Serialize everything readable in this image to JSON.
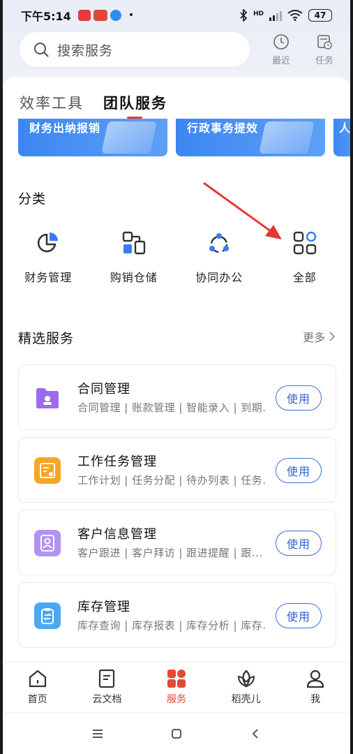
{
  "status_bar": {
    "time": "下午5:14",
    "battery": "47",
    "hd_label": "HD"
  },
  "search": {
    "placeholder": "搜索服务"
  },
  "top_actions": {
    "recent_label": "最近",
    "tasks_label": "任务"
  },
  "tabs": [
    {
      "label": "效率工具",
      "active": false
    },
    {
      "label": "团队服务",
      "active": true
    }
  ],
  "banners": [
    {
      "label": "财务出纳报销"
    },
    {
      "label": "行政事务提效"
    },
    {
      "label": "人"
    }
  ],
  "categories_section": {
    "title": "分类",
    "items": [
      {
        "label": "财务管理",
        "icon": "pie-chart-icon"
      },
      {
        "label": "购销仓储",
        "icon": "boxes-icon"
      },
      {
        "label": "协同办公",
        "icon": "collaboration-icon"
      },
      {
        "label": "全部",
        "icon": "grid-icon"
      }
    ]
  },
  "featured_section": {
    "title": "精选服务",
    "more_label": "更多"
  },
  "services": [
    {
      "name": "合同管理",
      "desc": "合同管理 | 账款管理 | 智能录入 | 到期...",
      "button": "使用",
      "icon": "contract-folder-icon",
      "color": "#8a5ce6"
    },
    {
      "name": "工作任务管理",
      "desc": "工作计划 | 任务分配 | 待办列表 | 任务...",
      "button": "使用",
      "icon": "task-board-icon",
      "color": "#f5a623"
    },
    {
      "name": "客户信息管理",
      "desc": "客户跟进 | 客户拜访 | 跟进提醒 | 跟...",
      "button": "使用",
      "icon": "customer-card-icon",
      "color": "#b08cf0"
    },
    {
      "name": "库存管理",
      "desc": "库存查询 | 库存报表 | 库存分析 | 库存...",
      "button": "使用",
      "icon": "inventory-clipboard-icon",
      "color": "#4aa8f0"
    }
  ],
  "bottom_nav": [
    {
      "label": "首页",
      "icon": "home-icon",
      "active": false
    },
    {
      "label": "云文档",
      "icon": "document-icon",
      "active": false
    },
    {
      "label": "服务",
      "icon": "services-grid-icon",
      "active": true
    },
    {
      "label": "稻壳儿",
      "icon": "leaf-icon",
      "active": false
    },
    {
      "label": "我",
      "icon": "person-icon",
      "active": false
    }
  ],
  "colors": {
    "accent_red": "#e24a33",
    "link_blue": "#2b5fd0",
    "banner_blue": "#3d86f2"
  }
}
